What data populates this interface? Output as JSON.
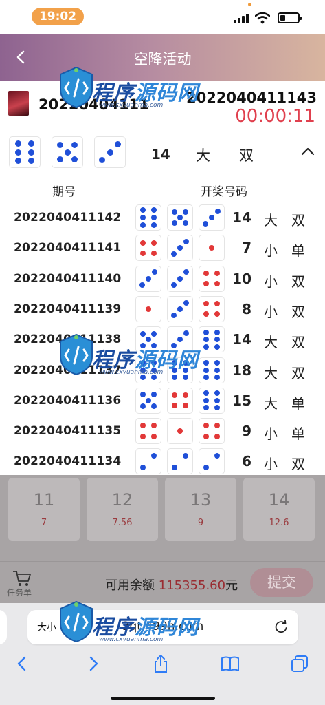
{
  "status_bar": {
    "time": "19:02",
    "battery_level": 0.3
  },
  "nav": {
    "title": "空降活动",
    "back_icon": "chevron-left-icon"
  },
  "current": {
    "period_partial": "20220404111",
    "next_period": "2022040411143",
    "countdown": "00:00:11"
  },
  "latest": {
    "dice": [
      6,
      5,
      3
    ],
    "sum": "14",
    "big_small": "大",
    "odd_even": "双"
  },
  "history_header": {
    "period": "期号",
    "numbers": "开奖号码"
  },
  "history": [
    {
      "period": "2022040411142",
      "dice": [
        6,
        5,
        3
      ],
      "sum": "14",
      "big_small": "大",
      "odd_even": "双"
    },
    {
      "period": "2022040411141",
      "dice": [
        4,
        3,
        1
      ],
      "sum": "7",
      "big_small": "小",
      "odd_even": "单"
    },
    {
      "period": "2022040411140",
      "dice": [
        3,
        3,
        4
      ],
      "sum": "10",
      "big_small": "小",
      "odd_even": "双"
    },
    {
      "period": "2022040411139",
      "dice": [
        1,
        3,
        4
      ],
      "sum": "8",
      "big_small": "小",
      "odd_even": "双"
    },
    {
      "period": "2022040411138",
      "dice": [
        5,
        3,
        6
      ],
      "sum": "14",
      "big_small": "大",
      "odd_even": "双"
    },
    {
      "period": "2022040411137",
      "dice": [
        6,
        6,
        6
      ],
      "sum": "18",
      "big_small": "大",
      "odd_even": "双"
    },
    {
      "period": "2022040411136",
      "dice": [
        5,
        4,
        6
      ],
      "sum": "15",
      "big_small": "大",
      "odd_even": "单"
    },
    {
      "period": "2022040411135",
      "dice": [
        4,
        1,
        4
      ],
      "sum": "9",
      "big_small": "小",
      "odd_even": "单"
    },
    {
      "period": "2022040411134",
      "dice": [
        2,
        2,
        2
      ],
      "sum": "6",
      "big_small": "小",
      "odd_even": "双"
    }
  ],
  "odds": [
    {
      "number": "11",
      "odds": "7"
    },
    {
      "number": "12",
      "odds": "7.56"
    },
    {
      "number": "13",
      "odds": "9"
    },
    {
      "number": "14",
      "odds": "12.6"
    }
  ],
  "bottom": {
    "cart_label": "任务单",
    "balance_label": "可用余额",
    "balance_amount": "115355.60",
    "balance_unit": "元",
    "submit_label": "提交"
  },
  "browser": {
    "text_size": "大小",
    "url": "3qt.499h.com"
  },
  "watermark": {
    "text_a": "程序",
    "text_b": "源码网",
    "url": "www.cxyuanma.com"
  },
  "colors": {
    "die_blue": "#1f4fd8",
    "die_red": "#e23838",
    "countdown": "#e0404e",
    "nav_start": "#8e6390",
    "nav_end": "#d8b59f"
  }
}
